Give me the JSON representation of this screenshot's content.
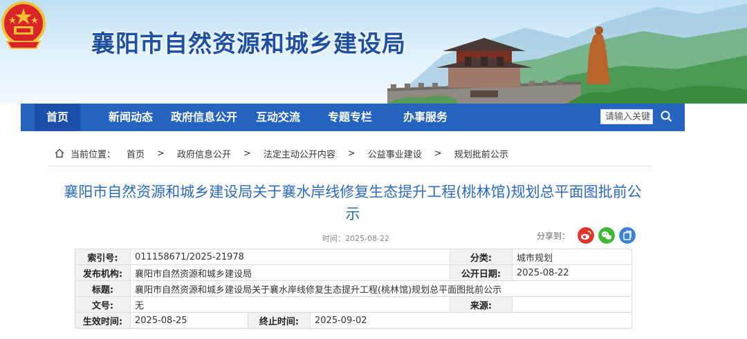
{
  "header": {
    "site_title": "襄阳市自然资源和城乡建设局"
  },
  "nav": {
    "items": [
      {
        "label": "首页",
        "active": true
      },
      {
        "label": "新闻动态"
      },
      {
        "label": "政府信息公开"
      },
      {
        "label": "互动交流"
      },
      {
        "label": "专题专栏"
      },
      {
        "label": "办事服务"
      }
    ],
    "search_placeholder": "请输入关键",
    "search_icon": "search-icon"
  },
  "breadcrumb": {
    "prefix": "当前位置：",
    "items": [
      "首页",
      "政府信息公开",
      "法定主动公开内容",
      "公益事业建设",
      "规划批前公示"
    ],
    "separator": ">"
  },
  "article": {
    "title": "襄阳市自然资源和城乡建设局关于襄水岸线修复生态提升工程(桃林馆)规划总平面图批前公示",
    "date_text": "时间：2025-08-22",
    "share_label": "分享到："
  },
  "info_table": {
    "index_label": "索引号:",
    "index_value": "011158671/2025-21978",
    "category_label": "分类:",
    "category_value": "城市规划",
    "publisher_label": "发布机构:",
    "publisher_value": "襄阳市自然资源和城乡建设局",
    "pubdate_label": "公开日期:",
    "pubdate_value": "2025-08-22",
    "title_label": "标题:",
    "title_value": "襄阳市自然资源和城乡建设局关于襄水岸线修复生态提升工程(桃林馆)规划总平面图批前公示",
    "docno_label": "文号:",
    "docno_value": "无",
    "source_label": "来源:",
    "source_value": "",
    "effective_label": "生效时间:",
    "effective_value": "2025-08-25",
    "expire_label": "终止时间:",
    "expire_value": "2025-09-02"
  },
  "colors": {
    "nav_bg": "#2563c0",
    "title_blue": "#2a6bc4",
    "weibo_red": "#e6332a",
    "wechat_green": "#3fb837",
    "share_blue": "#3b83d6"
  }
}
